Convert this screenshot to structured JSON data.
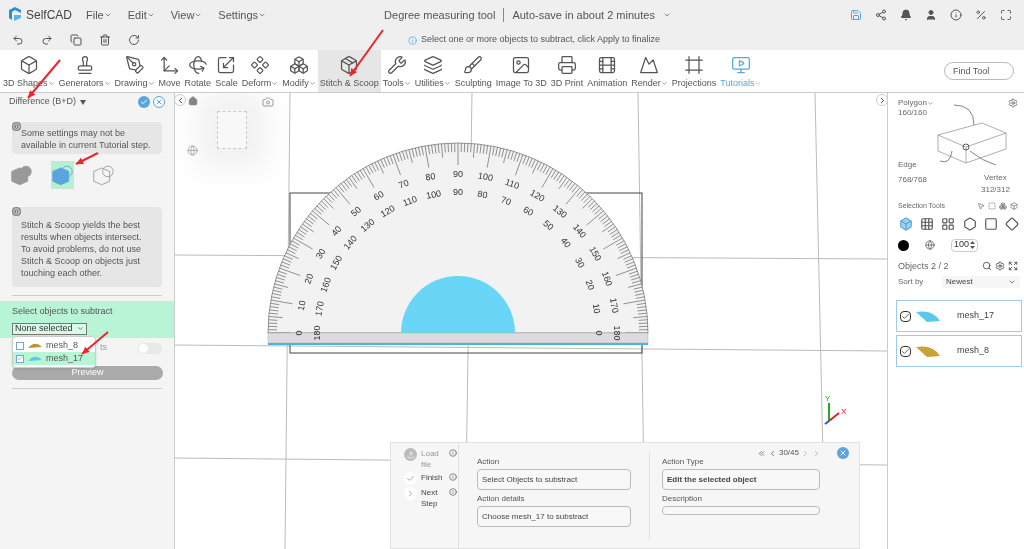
{
  "app": {
    "logo": "SelfCAD",
    "menus": [
      {
        "label": "File"
      },
      {
        "label": "Edit"
      },
      {
        "label": "View"
      },
      {
        "label": "Settings"
      }
    ],
    "project_title": "Degree measuring tool",
    "autosave": "Auto-save in about 2 minutes"
  },
  "hint": "Select one or more objects to subtract, click Apply to finalize",
  "toolbar": {
    "tools": [
      {
        "label": "3D Shapes",
        "menu": true,
        "kind": "tool",
        "selected": false
      },
      {
        "label": "Generators",
        "menu": true,
        "kind": "tool",
        "selected": false
      },
      {
        "label": "Drawing",
        "menu": true,
        "kind": "tool",
        "selected": false
      },
      {
        "label": "Move",
        "menu": false,
        "kind": "tool",
        "selected": false
      },
      {
        "label": "Rotate",
        "menu": false,
        "kind": "tool",
        "selected": false
      },
      {
        "label": "Scale",
        "menu": false,
        "kind": "tool",
        "selected": false
      },
      {
        "label": "Deform",
        "menu": true,
        "kind": "tool",
        "selected": false
      },
      {
        "label": "Modify",
        "menu": true,
        "kind": "tool",
        "selected": false
      },
      {
        "label": "Stitch & Scoop",
        "menu": false,
        "kind": "tool",
        "selected": true
      },
      {
        "label": "Tools",
        "menu": true,
        "kind": "tool",
        "selected": false
      },
      {
        "label": "Utilities",
        "menu": true,
        "kind": "tool",
        "selected": false
      },
      {
        "label": "Sculpting",
        "menu": false,
        "kind": "tool",
        "selected": false
      },
      {
        "label": "Image To 3D",
        "menu": false,
        "kind": "tool",
        "selected": false
      },
      {
        "label": "3D Print",
        "menu": false,
        "kind": "tool",
        "selected": false
      },
      {
        "label": "Animation",
        "menu": false,
        "kind": "tool",
        "selected": false
      },
      {
        "label": "Render",
        "menu": true,
        "kind": "tool",
        "selected": false
      },
      {
        "label": "Projections",
        "menu": false,
        "kind": "tool",
        "selected": false
      },
      {
        "label": "Tutorials",
        "menu": true,
        "kind": "link",
        "selected": false
      }
    ],
    "search": {
      "placeholder": "Find Tool"
    }
  },
  "left_panel": {
    "title": "Difference (B+D)",
    "notice": "Some settings may not be available in current Tutorial step.",
    "modes": [
      {
        "kind": "union",
        "selected": false
      },
      {
        "kind": "difference",
        "selected": true
      },
      {
        "kind": "intersection",
        "selected": false
      }
    ],
    "tip": "Stitch & Scoop yields the best results when objects intersect. To avoid problems, do not use Stitch & Scoop on objects just touching each other.",
    "subtract": {
      "label": "Select objects to subtract",
      "value": "None selected",
      "options": [
        {
          "name": "mesh_8",
          "checked": false,
          "color": "#b8952e"
        },
        {
          "name": "mesh_17",
          "checked": true,
          "color": "#5bc8ee"
        }
      ]
    },
    "toggle": {
      "label": "ts",
      "on": false
    },
    "preview": {
      "label": "Preview",
      "disabled": true
    }
  },
  "right_panel": {
    "polygon": {
      "label": "Polygon",
      "count": "160/160"
    },
    "edge": {
      "label": "Edge",
      "count": "768/768"
    },
    "vertex": {
      "label": "Vertex",
      "count": "312/312"
    },
    "selection_tools": {
      "label": "Selection Tools",
      "modes": [
        {
          "kind": "object",
          "selected": true
        },
        {
          "kind": "grid",
          "selected": false
        },
        {
          "kind": "dense",
          "selected": false
        },
        {
          "kind": "hex",
          "selected": false
        },
        {
          "kind": "face",
          "selected": false
        },
        {
          "kind": "plane",
          "selected": false
        }
      ]
    },
    "size": "100",
    "objects": {
      "label": "Objects 2 / 2",
      "sort_label": "Sort by",
      "sort": "Newest",
      "items": [
        {
          "name": "mesh_17",
          "checked": true,
          "color": "#5bc8ee"
        },
        {
          "name": "mesh_8",
          "checked": true,
          "color": "#c9a23a"
        }
      ]
    }
  },
  "viewport": {
    "protractor": {
      "outer_scale": [
        "0",
        "10",
        "20",
        "30",
        "40",
        "50",
        "60",
        "70",
        "80",
        "90",
        "100",
        "110",
        "120",
        "130",
        "140",
        "150",
        "160",
        "170",
        "180"
      ],
      "inner_scale": [
        "180",
        "170",
        "160",
        "150",
        "140",
        "130",
        "120",
        "110",
        "100",
        "90",
        "80",
        "70",
        "60",
        "50",
        "40",
        "30",
        "20",
        "10",
        "0"
      ]
    },
    "axes": [
      {
        "label": "Y",
        "color": "#22aa22"
      },
      {
        "label": "X",
        "color": "#dd2222"
      }
    ]
  },
  "tutorial": {
    "steps": [
      {
        "label": "Load file",
        "kind": "load",
        "disabled": true
      },
      {
        "label": "Finish",
        "kind": "finish",
        "disabled": false
      },
      {
        "label": "Next Step",
        "kind": "next",
        "disabled": false
      }
    ],
    "page": "30/45",
    "fields": [
      {
        "label": "Action",
        "value": "Select Objects to substract",
        "bold": false
      },
      {
        "label": "Action details",
        "value": "Choose mesh_17 to substract",
        "bold": false
      },
      {
        "label": "Action Type",
        "value": "Edit the selected object",
        "bold": true
      },
      {
        "label": "Description"
      }
    ]
  }
}
